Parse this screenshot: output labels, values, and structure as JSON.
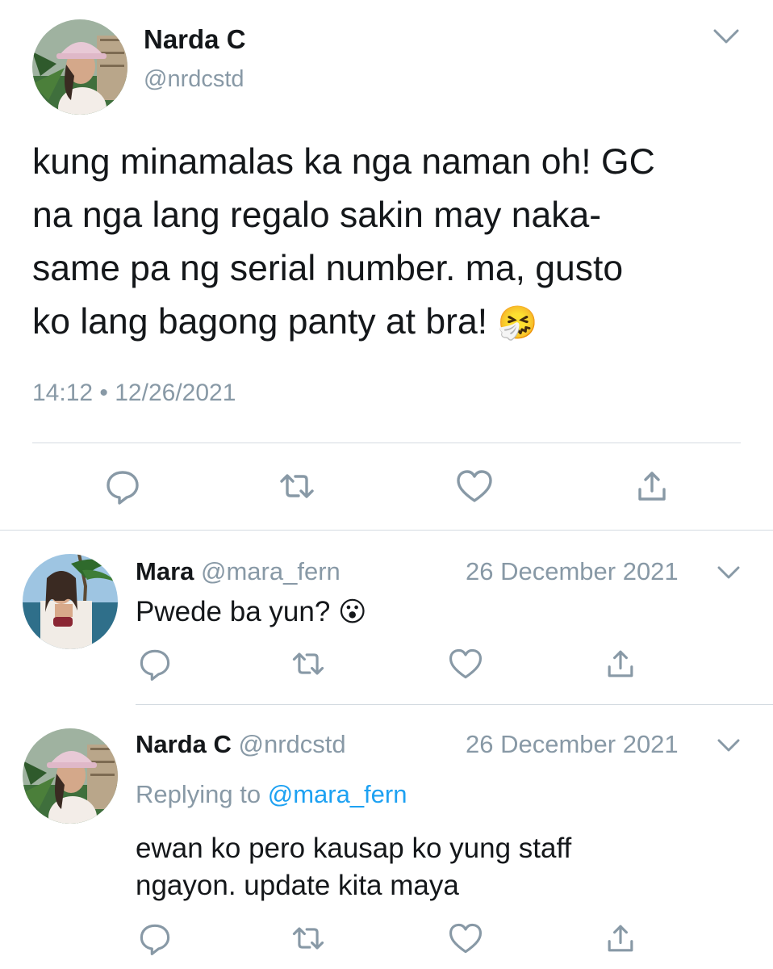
{
  "main_tweet": {
    "name": "Narda C",
    "handle": "@nrdcstd",
    "text_lines": [
      "kung minamalas ka nga naman oh! GC",
      "na nga lang regalo sakin may naka-",
      "same pa ng serial number. ma, gusto",
      "ko lang bagong panty at bra!"
    ],
    "emoji": "🤧",
    "timestamp": "14:12 • 12/26/2021"
  },
  "replies": [
    {
      "name": "Mara",
      "handle": "@mara_fern",
      "date": "26 December 2021",
      "text": "Pwede ba yun?",
      "emoji": "😮"
    },
    {
      "name": "Narda C",
      "handle": "@nrdcstd",
      "date": "26 December 2021",
      "replying_prefix": "Replying to",
      "replying_to": "@mara_fern",
      "text_lines": [
        "ewan ko pero kausap ko yung staff",
        "ngayon. update kita maya"
      ]
    }
  ],
  "icons": [
    "chevron-down-icon",
    "reply-icon",
    "retweet-icon",
    "like-icon",
    "share-icon"
  ],
  "colors": {
    "text": "#14171a",
    "secondary": "#8899a6",
    "link": "#1da1f2",
    "divider": "#d4dbe1"
  }
}
